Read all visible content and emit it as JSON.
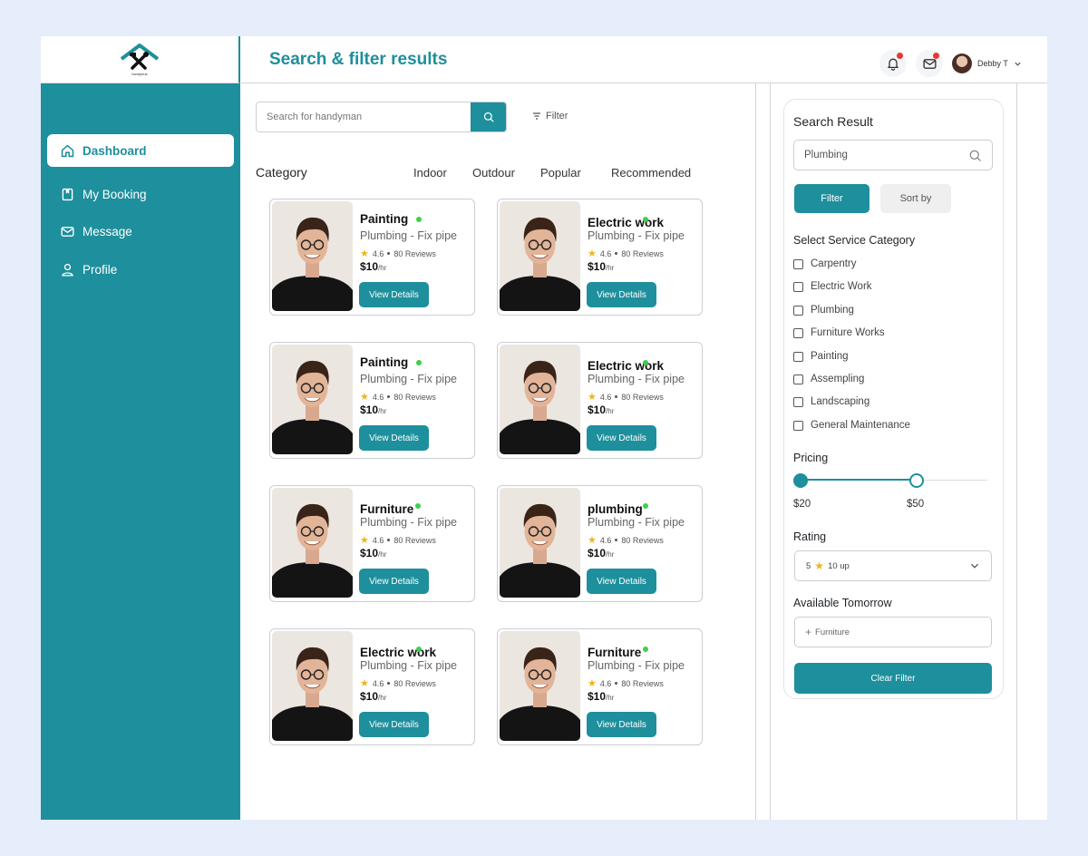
{
  "app": {
    "logo_text": "handyhub"
  },
  "sidebar": {
    "items": [
      {
        "label": "Dashboard",
        "icon": "home-icon",
        "active": true
      },
      {
        "label": "My Booking",
        "icon": "booking-icon",
        "active": false
      },
      {
        "label": "Message",
        "icon": "mail-icon",
        "active": false
      },
      {
        "label": "Profile",
        "icon": "user-icon",
        "active": false
      }
    ]
  },
  "header": {
    "title": "Search & filter results",
    "user_name": "Debby T"
  },
  "search": {
    "placeholder": "Search for handyman",
    "filter_label": "Filter"
  },
  "category": {
    "title": "Category",
    "tabs": [
      "Indoor",
      "Outdour",
      "Popular",
      "Recommended"
    ]
  },
  "cards": [
    {
      "name": "Painting",
      "service": "Plumbing - Fix pipe",
      "rating": "4.6",
      "reviews": "80 Reviews",
      "price": "$10",
      "unit": "/hr",
      "button": "View Details"
    },
    {
      "name": "Electric work",
      "service": "Plumbing - Fix pipe",
      "rating": "4.6",
      "reviews": "80 Reviews",
      "price": "$10",
      "unit": "/hr",
      "button": "View Details"
    },
    {
      "name": "Painting",
      "service": "Plumbing - Fix pipe",
      "rating": "4.6",
      "reviews": "80 Reviews",
      "price": "$10",
      "unit": "/hr",
      "button": "View Details"
    },
    {
      "name": "Electric work",
      "service": "Plumbing - Fix pipe",
      "rating": "4.6",
      "reviews": "80 Reviews",
      "price": "$10",
      "unit": "/hr",
      "button": "View Details"
    },
    {
      "name": "Furniture",
      "service": "Plumbing - Fix pipe",
      "rating": "4.6",
      "reviews": "80 Reviews",
      "price": "$10",
      "unit": "/hr",
      "button": "View Details"
    },
    {
      "name": "plumbing",
      "service": "Plumbing - Fix pipe",
      "rating": "4.6",
      "reviews": "80 Reviews",
      "price": "$10",
      "unit": "/hr",
      "button": "View Details"
    },
    {
      "name": "Electric work",
      "service": "Plumbing - Fix pipe",
      "rating": "4.6",
      "reviews": "80 Reviews",
      "price": "$10",
      "unit": "/hr",
      "button": "View Details"
    },
    {
      "name": "Furniture",
      "service": "Plumbing - Fix pipe",
      "rating": "4.6",
      "reviews": "80 Reviews",
      "price": "$10",
      "unit": "/hr",
      "button": "View Details"
    }
  ],
  "filter_panel": {
    "title": "Search Result",
    "search_value": "Plumbing",
    "tab_filter": "Filter",
    "tab_sort": "Sort by",
    "service_heading": "Select Service Category",
    "services": [
      "Carpentry",
      "Electric Work",
      "Plumbing",
      "Furniture Works",
      "Painting",
      "Assempling",
      "Landscaping",
      "General Maintenance"
    ],
    "pricing_heading": "Pricing",
    "price_min": "$20",
    "price_max": "$50",
    "price_range_fraction": [
      0,
      0.62
    ],
    "rating_heading": "Rating",
    "rating_min": "5",
    "rating_value": "10 up",
    "available_heading": "Available Tomorrow",
    "available_value": "Furniture",
    "clear_label": "Clear Filter"
  },
  "colors": {
    "accent": "#1e8f9c",
    "online": "#3fcf4a",
    "notify": "#e53935",
    "star": "#f2b418"
  }
}
